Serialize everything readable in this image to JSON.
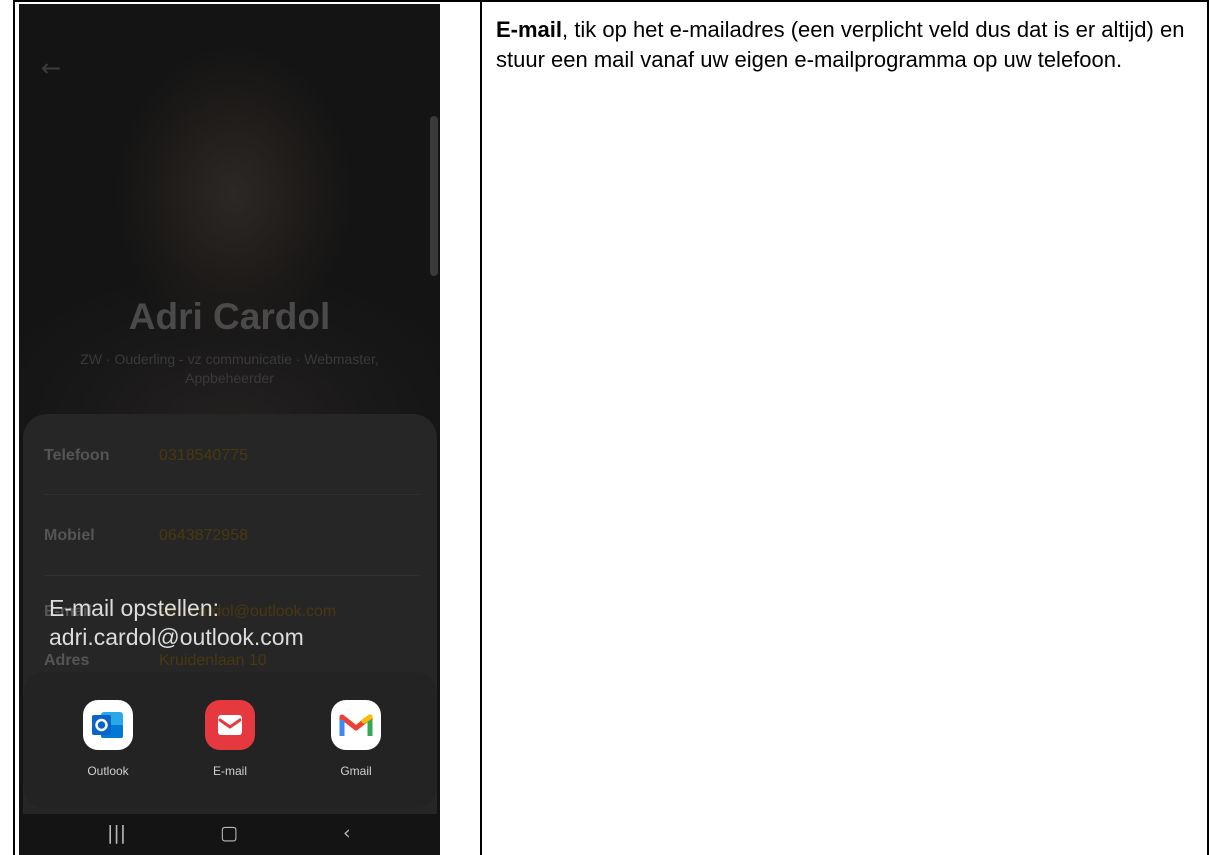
{
  "phone": {
    "back_icon": "arrow-left",
    "person_name": "Adri Cardol",
    "person_roles_line1": "ZW · Ouderling - vz communicatie · Webmaster,",
    "person_roles_line2": "Appbeheerder",
    "rows": [
      {
        "label": "Telefoon",
        "value": "0318540775"
      },
      {
        "label": "Mobiel",
        "value": "0643872958"
      },
      {
        "label": "E-mail",
        "value": "adri.cardol@outlook.com"
      },
      {
        "label": "Adres",
        "value": "Kruidenlaan 10"
      }
    ],
    "toast_line1": "E-mail opstellen:",
    "toast_line2": "adri.cardol@outlook.com",
    "apps": [
      {
        "label": "Outlook",
        "icon": "outlook-icon",
        "color": "#0a64c8"
      },
      {
        "label": "E-mail",
        "icon": "email-envelope-icon",
        "color": "#e5393f"
      },
      {
        "label": "Gmail",
        "icon": "gmail-icon",
        "color": "#ffffff"
      }
    ],
    "nav_icons": [
      "recent-apps",
      "home",
      "back"
    ]
  },
  "description": {
    "bold": "E-mail",
    "text": ", tik op het e-mailadres (een verplicht veld dus dat is er altijd) en stuur een mail vanaf uw eigen e-mailprogramma op uw telefoon."
  }
}
